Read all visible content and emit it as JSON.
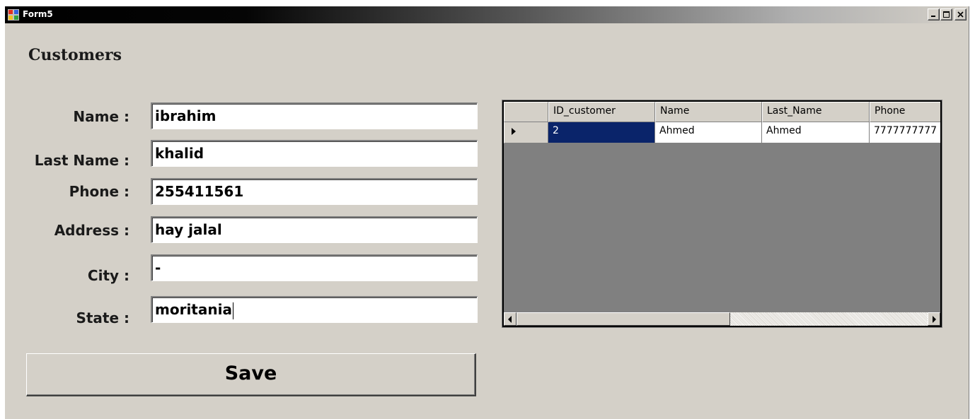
{
  "window": {
    "title": "Form5",
    "icon": "app-icon",
    "caption_buttons": [
      "minimize-icon",
      "maximize-icon",
      "close-icon"
    ]
  },
  "form": {
    "heading": "Customers",
    "fields": [
      {
        "label": "Name :",
        "value": "ibrahim"
      },
      {
        "label": "Last Name :",
        "value": "khalid"
      },
      {
        "label": "Phone :",
        "value": "255411561"
      },
      {
        "label": "Address :",
        "value": "hay jalal"
      },
      {
        "label": "City :",
        "value": "-"
      },
      {
        "label": "State :",
        "value": "moritania"
      }
    ],
    "save_label": "Save"
  },
  "grid": {
    "columns": [
      "ID_customer",
      "Name",
      "Last_Name",
      "Phone"
    ],
    "rows": [
      [
        "2",
        "Ahmed",
        "Ahmed",
        "7777777777"
      ]
    ],
    "selected_cell_color": "#0a246a"
  }
}
